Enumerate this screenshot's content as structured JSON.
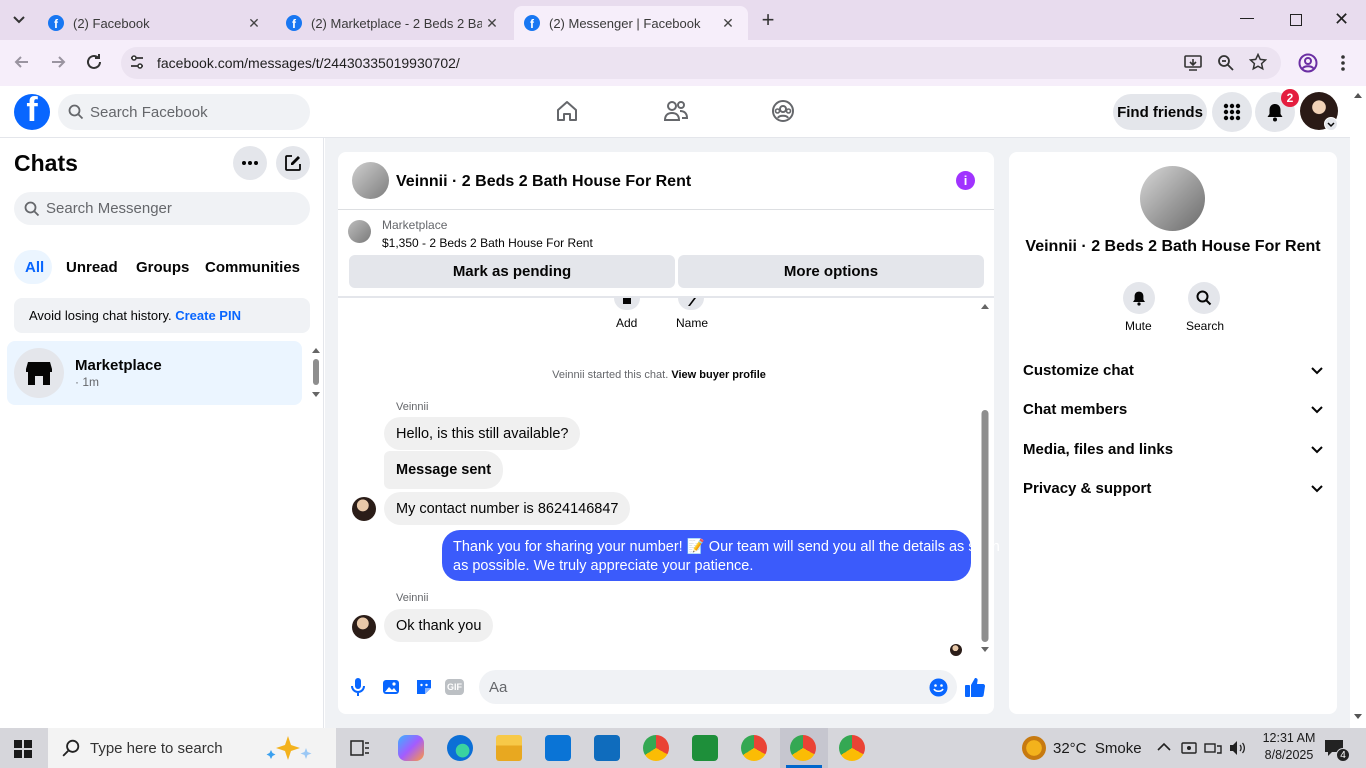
{
  "browser": {
    "tabs": [
      {
        "title": "(2) Facebook"
      },
      {
        "title": "(2) Marketplace - 2 Beds 2 Bath"
      },
      {
        "title": "(2) Messenger | Facebook"
      }
    ],
    "url": "facebook.com/messages/t/24430335019930702/"
  },
  "fb_header": {
    "search_placeholder": "Search Facebook",
    "find_friends_label": "Find friends",
    "notification_count": "2"
  },
  "sidebar": {
    "title": "Chats",
    "search_placeholder": "Search Messenger",
    "filters": [
      "All",
      "Unread",
      "Groups",
      "Communities"
    ],
    "notice_text": "Avoid losing chat history.",
    "notice_link": "Create PIN",
    "chats": [
      {
        "name": "Marketplace",
        "meta": "· 1m"
      }
    ]
  },
  "conversation": {
    "title": "Veinnii · 2 Beds 2 Bath House For Rent",
    "listing_label": "Marketplace",
    "listing_detail": "$1,350 - 2 Beds 2 Bath House For Rent",
    "mark_pending_label": "Mark as pending",
    "more_options_label": "More options",
    "action_add_label": "Add",
    "action_name_label": "Name",
    "started_text": "Veinnii started this chat.",
    "view_buyer_profile": "View buyer profile",
    "sender_name": "Veinnii",
    "messages": [
      {
        "text": "Hello, is this still available?"
      },
      {
        "text": "Message sent"
      },
      {
        "text": "My contact number is 8624146847"
      },
      {
        "line1": "Thank you for sharing your number! 📝 Our team will send you all the details as soon",
        "line2": "as possible. We truly appreciate your patience."
      },
      {
        "text": "Ok thank you"
      }
    ],
    "composer_placeholder": "Aa",
    "gif_label": "GIF"
  },
  "details": {
    "title": "Veinnii · 2 Beds 2 Bath House For Rent",
    "mute_label": "Mute",
    "search_label": "Search",
    "sections": [
      "Customize chat",
      "Chat members",
      "Media, files and links",
      "Privacy & support"
    ]
  },
  "taskbar": {
    "search_placeholder": "Type here to search",
    "weather": "32°C  Smoke",
    "time": "12:31 AM",
    "date": "8/8/2025",
    "notif_count": "4"
  },
  "colors": {
    "brand": "#0866ff",
    "outgoing_bubble": "#3b5bfb",
    "accent_purple": "#a033ff"
  }
}
